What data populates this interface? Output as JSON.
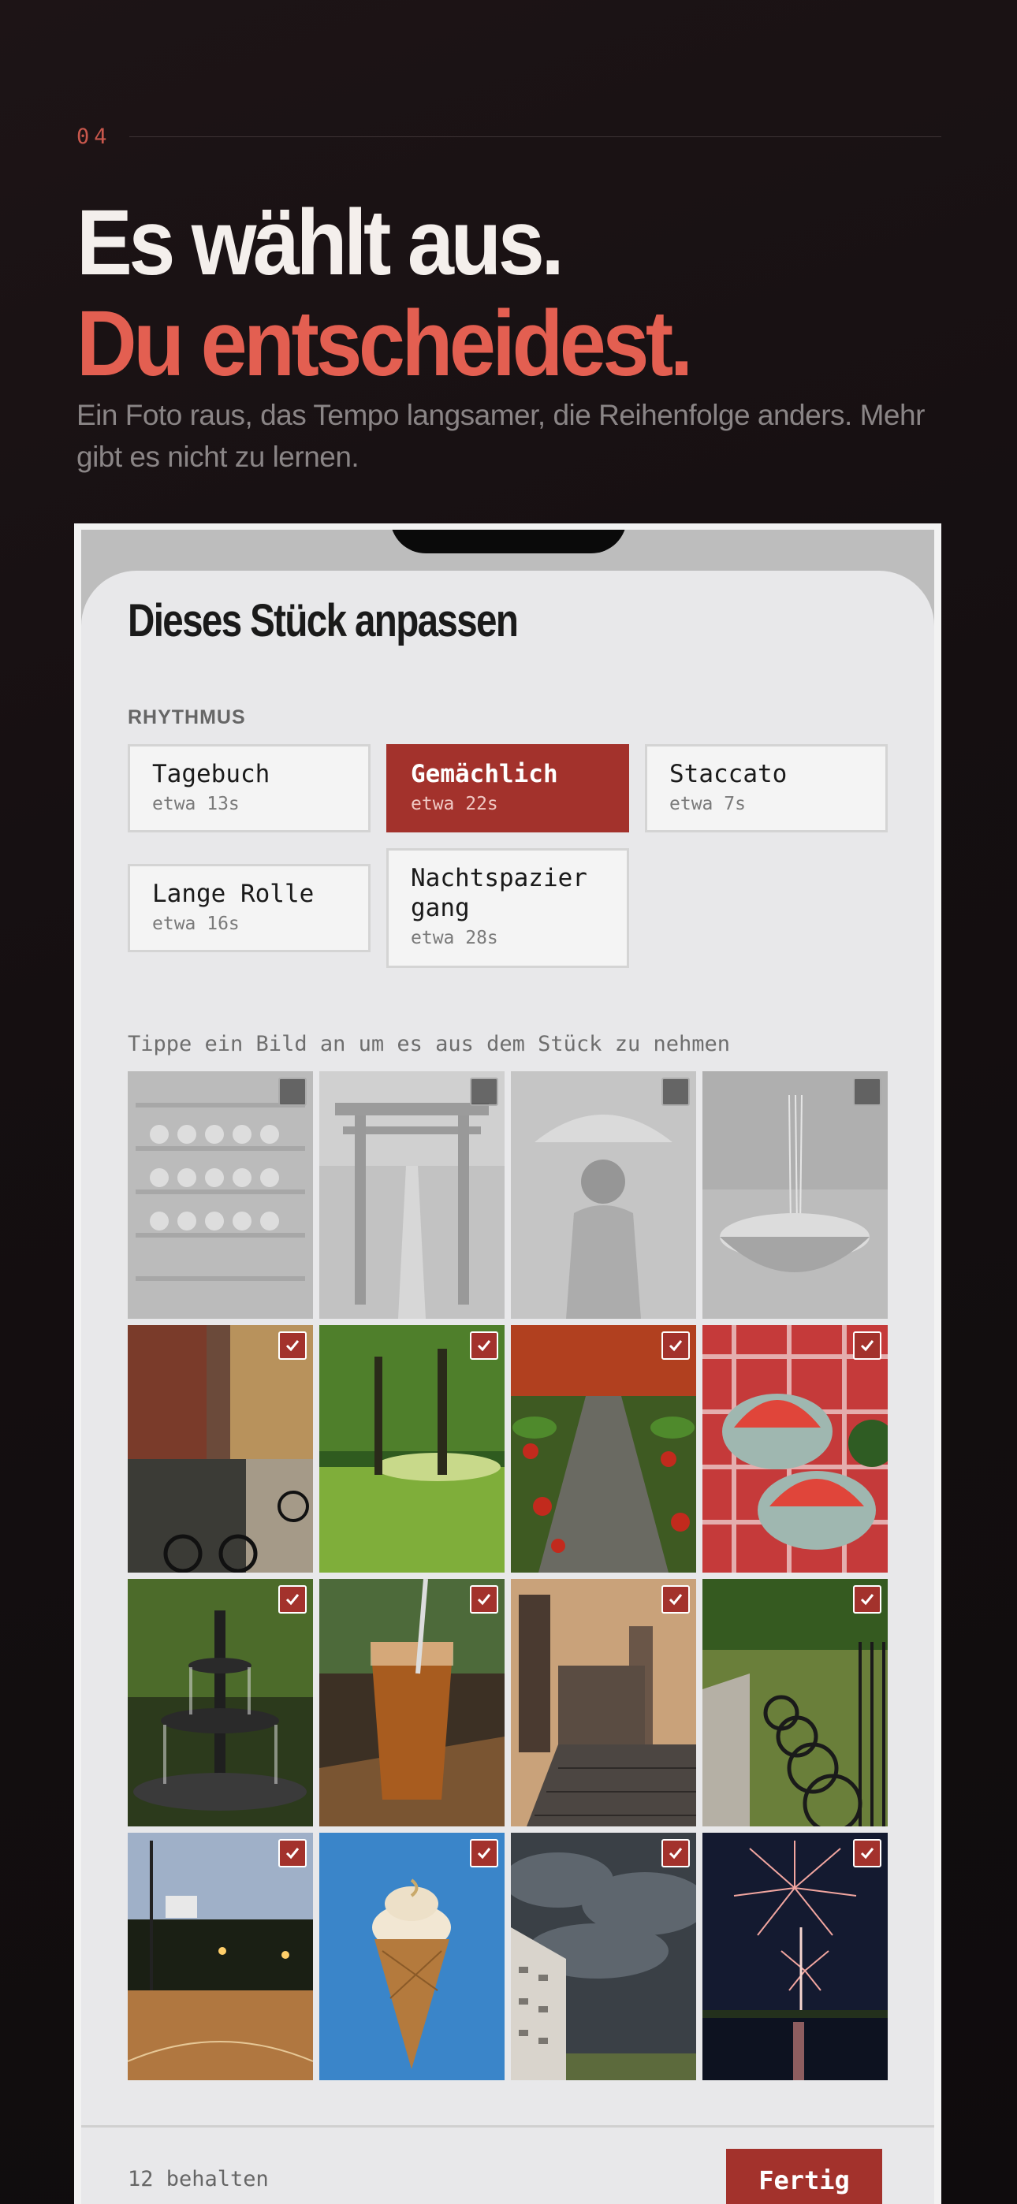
{
  "section": {
    "number": "04"
  },
  "hero": {
    "line1": "Es wählt aus.",
    "line2": "Du entscheidest.",
    "subcopy": "Ein Foto raus, das Tempo langsamer, die Reihenfolge anders. Mehr gibt es nicht zu lernen."
  },
  "sheet": {
    "title": "Dieses Stück anpassen",
    "rhythm_label": "RHYTHMUS",
    "options": [
      {
        "name": "Tagebuch",
        "duration": "etwa 13s",
        "selected": false
      },
      {
        "name": "Gemächlich",
        "duration": "etwa 22s",
        "selected": true
      },
      {
        "name": "Staccato",
        "duration": "etwa 7s",
        "selected": false
      },
      {
        "name": "Lange Rolle",
        "duration": "etwa 16s",
        "selected": false
      },
      {
        "name": "Nachtspazier gang",
        "duration": "etwa 28s",
        "selected": false
      }
    ],
    "hint": "Tippe ein Bild an um es aus dem Stück zu nehmen",
    "photos": [
      {
        "subject": "ceramic-shelves",
        "kept": false
      },
      {
        "subject": "torii-gate-path",
        "kept": false
      },
      {
        "subject": "person-with-umbrella",
        "kept": false
      },
      {
        "subject": "noodle-bowl",
        "kept": false
      },
      {
        "subject": "canal-bicycles",
        "kept": true
      },
      {
        "subject": "sunny-park",
        "kept": true
      },
      {
        "subject": "stone-path-red-leaves",
        "kept": true
      },
      {
        "subject": "watermelon-picnic",
        "kept": true
      },
      {
        "subject": "fountain",
        "kept": true
      },
      {
        "subject": "iced-tea",
        "kept": true
      },
      {
        "subject": "city-rooftops",
        "kept": true
      },
      {
        "subject": "parked-bicycles",
        "kept": true
      },
      {
        "subject": "basketball-court-night",
        "kept": true
      },
      {
        "subject": "ice-cream-cone",
        "kept": true
      },
      {
        "subject": "storm-clouds-buildings",
        "kept": true
      },
      {
        "subject": "fireworks-over-water",
        "kept": true
      }
    ],
    "footer": {
      "kept_count": "12 behalten",
      "done_label": "Fertig"
    }
  },
  "colors": {
    "accent": "#a3322c",
    "headline_accent": "#e35f51",
    "background": "#150f11"
  }
}
